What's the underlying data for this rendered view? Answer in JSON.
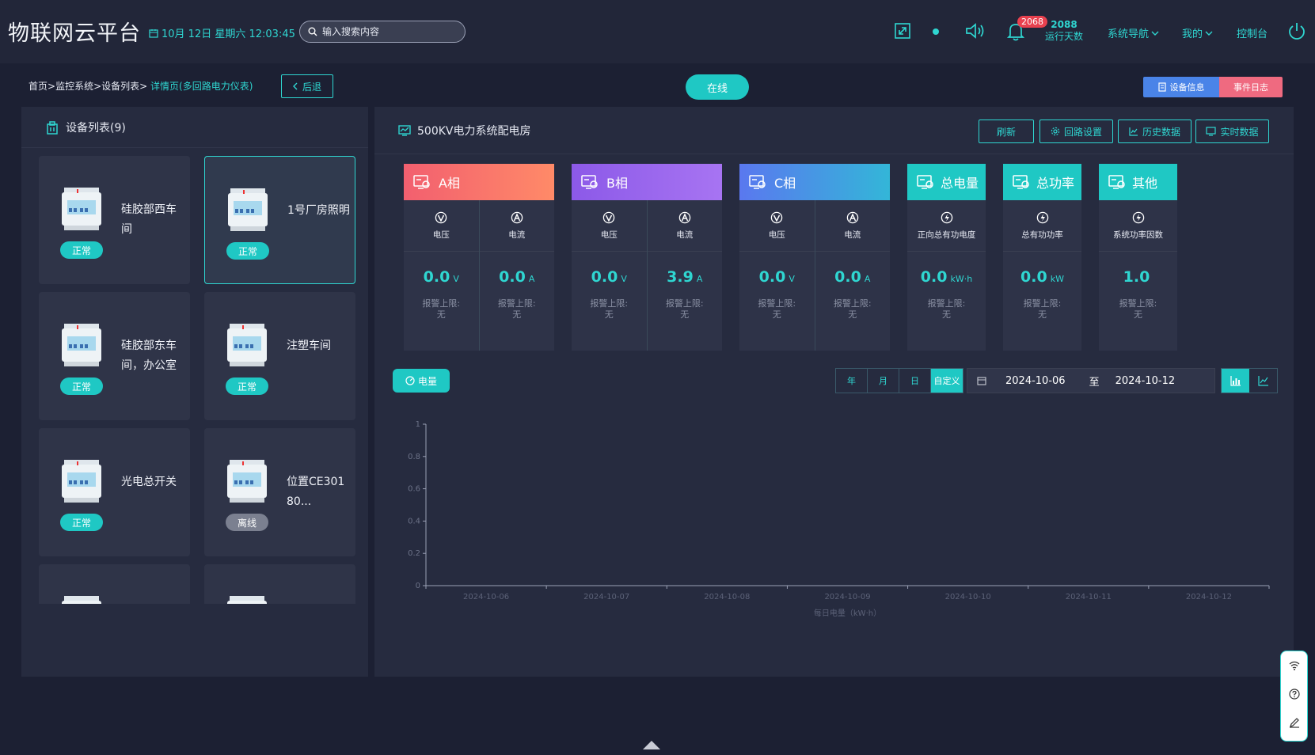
{
  "header": {
    "brand": "物联网云平台",
    "datetime": "10月 12日 星期六 12:03:45",
    "search_placeholder": "输入搜索内容",
    "alarm_count": "2068",
    "run_days_value": "2088",
    "run_days_label": "运行天数",
    "nav": {
      "system_nav": "系统导航",
      "mine": "我的",
      "console": "控制台"
    }
  },
  "breadcrumb": {
    "home": "首页",
    "monitor": "监控系统",
    "device_list": "设备列表",
    "current": "详情页(多回路电力仪表)",
    "back_label": "后退"
  },
  "status": {
    "online": "在线"
  },
  "top_buttons": {
    "device_info": "设备信息",
    "event_log": "事件日志"
  },
  "device_list": {
    "title": "设备列表(9)",
    "items": [
      {
        "name": "硅胶部西车间",
        "status": "正常"
      },
      {
        "name": "1号厂房照明",
        "status": "正常"
      },
      {
        "name": "硅胶部东车间，办公室",
        "status": "正常"
      },
      {
        "name": "注塑车间",
        "status": "正常"
      },
      {
        "name": "光电总开关",
        "status": "正常"
      },
      {
        "name": "位置CE30180...",
        "status": "离线"
      }
    ]
  },
  "detail": {
    "title": "500KV电力系统配电房",
    "buttons": {
      "refresh": "刷新",
      "loop": "回路设置",
      "history": "历史数据",
      "realtime": "实时数据"
    }
  },
  "cards": [
    {
      "title": "A相",
      "color_from": "#f25f6f",
      "color_to": "#ff8a68",
      "cols": [
        {
          "label": "电压",
          "value": "0.0",
          "unit": "V",
          "alarm": "报警上限:",
          "alarm_val": "无"
        },
        {
          "label": "电流",
          "value": "0.0",
          "unit": "A",
          "alarm": "报警上限:",
          "alarm_val": "无"
        }
      ]
    },
    {
      "title": "B相",
      "color_from": "#8c59e8",
      "color_to": "#a774f2",
      "cols": [
        {
          "label": "电压",
          "value": "0.0",
          "unit": "V",
          "alarm": "报警上限:",
          "alarm_val": "无"
        },
        {
          "label": "电流",
          "value": "3.9",
          "unit": "A",
          "alarm": "报警上限:",
          "alarm_val": "无"
        }
      ]
    },
    {
      "title": "C相",
      "color_from": "#5a78ef",
      "color_to": "#33b6d8",
      "cols": [
        {
          "label": "电压",
          "value": "0.0",
          "unit": "V",
          "alarm": "报警上限:",
          "alarm_val": "无"
        },
        {
          "label": "电流",
          "value": "0.0",
          "unit": "A",
          "alarm": "报警上限:",
          "alarm_val": "无"
        }
      ]
    },
    {
      "title": "总电量",
      "color_from": "#1fc8c4",
      "color_to": "#1fc8c4",
      "cols": [
        {
          "label": "正向总有功电度",
          "value": "0.0",
          "unit": "kW·h",
          "alarm": "报警上限:",
          "alarm_val": "无"
        }
      ]
    },
    {
      "title": "总功率",
      "color_from": "#1fc8c4",
      "color_to": "#1fc8c4",
      "cols": [
        {
          "label": "总有功功率",
          "value": "0.0",
          "unit": "kW",
          "alarm": "报警上限:",
          "alarm_val": "无"
        }
      ]
    },
    {
      "title": "其他",
      "color_from": "#1fc8c4",
      "color_to": "#1fc8c4",
      "cols": [
        {
          "label": "系统功率因数",
          "value": "1.0",
          "unit": "",
          "alarm": "报警上限:",
          "alarm_val": "无"
        }
      ]
    }
  ],
  "chart_controls": {
    "tab": "电量",
    "periods": [
      "年",
      "月",
      "日",
      "自定义"
    ],
    "active_period": "自定义",
    "start": "2024-10-06",
    "to": "至",
    "end": "2024-10-12"
  },
  "chart_data": {
    "type": "bar",
    "categories": [
      "2024-10-06",
      "2024-10-07",
      "2024-10-08",
      "2024-10-09",
      "2024-10-10",
      "2024-10-11",
      "2024-10-12"
    ],
    "values": [
      0,
      0,
      0,
      0,
      0,
      0,
      0
    ],
    "xlabel": "每日电量（kW·h）",
    "ylim": [
      0,
      1
    ],
    "yticks": [
      "0",
      "0.2",
      "0.4",
      "0.6",
      "0.8",
      "1"
    ],
    "grid": false,
    "axis_color": "#9aa0b5"
  }
}
